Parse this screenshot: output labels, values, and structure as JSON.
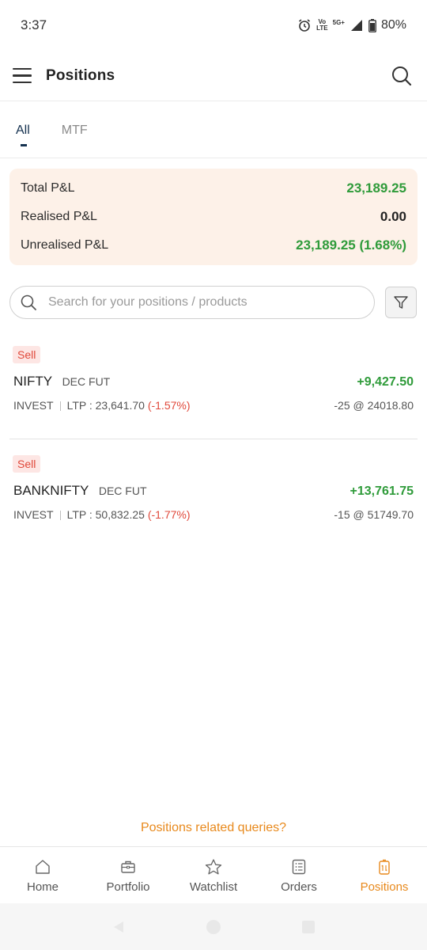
{
  "status_bar": {
    "time": "3:37",
    "network_top": "Vo",
    "network_bottom": "LTE",
    "network_5g": "5G+",
    "battery": "80%"
  },
  "header": {
    "title": "Positions"
  },
  "tabs": [
    {
      "label": "All",
      "active": true
    },
    {
      "label": "MTF",
      "active": false
    }
  ],
  "summary": {
    "total_label": "Total P&L",
    "total_value": "23,189.25",
    "realised_label": "Realised P&L",
    "realised_value": "0.00",
    "unrealised_label": "Unrealised P&L",
    "unrealised_value": "23,189.25 (1.68%)"
  },
  "search": {
    "placeholder": "Search for your positions / products"
  },
  "positions": [
    {
      "side": "Sell",
      "symbol": "NIFTY",
      "contract": "DEC FUT",
      "pnl": "+9,427.50",
      "product": "INVEST",
      "ltp_text": "LTP : 23,641.70",
      "change": "(-1.57%)",
      "qty_price": "-25 @ 24018.80"
    },
    {
      "side": "Sell",
      "symbol": "BANKNIFTY",
      "contract": "DEC FUT",
      "pnl": "+13,761.75",
      "product": "INVEST",
      "ltp_text": "LTP : 50,832.25",
      "change": "(-1.77%)",
      "qty_price": "-15 @ 51749.70"
    }
  ],
  "queries_link": "Positions related queries?",
  "bottom_nav": [
    {
      "label": "Home",
      "icon": "home-icon"
    },
    {
      "label": "Portfolio",
      "icon": "briefcase-icon"
    },
    {
      "label": "Watchlist",
      "icon": "star-icon"
    },
    {
      "label": "Orders",
      "icon": "orders-list-icon"
    },
    {
      "label": "Positions",
      "icon": "positions-icon",
      "active": true
    }
  ],
  "colors": {
    "profit": "#2f9b3a",
    "loss": "#e0483a",
    "accent": "#e8891c",
    "summary_bg": "#fdf1e8",
    "tab_active": "#14314f"
  }
}
